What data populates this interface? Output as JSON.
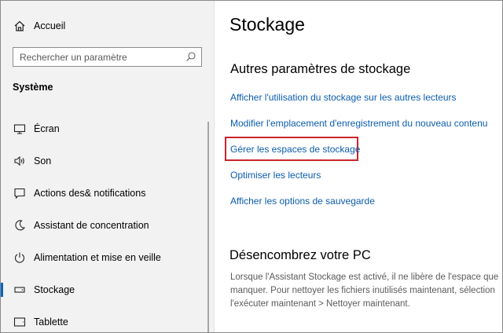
{
  "sidebar": {
    "home_label": "Accueil",
    "search_placeholder": "Rechercher un paramètre",
    "group_title": "Système",
    "items": [
      {
        "label": "Écran",
        "icon": "monitor-icon"
      },
      {
        "label": "Son",
        "icon": "speaker-icon"
      },
      {
        "label": "Actions des& notifications",
        "icon": "notification-icon"
      },
      {
        "label": "Assistant de concentration",
        "icon": "moon-icon"
      },
      {
        "label": "Alimentation et mise en veille",
        "icon": "power-icon"
      },
      {
        "label": "Stockage",
        "icon": "storage-icon",
        "active": true
      },
      {
        "label": "Tablette",
        "icon": "tablet-icon"
      }
    ]
  },
  "main": {
    "title": "Stockage",
    "section_title": "Autres paramètres de stockage",
    "links": [
      "Afficher l'utilisation du stockage sur les autres lecteurs",
      "Modifier l'emplacement d'enregistrement du nouveau contenu",
      "Gérer les espaces de stockage",
      "Optimiser les lecteurs",
      "Afficher les options de sauvegarde"
    ],
    "section2_title": "Désencombrez votre PC",
    "description_lines": [
      "Lorsque l'Assistant Stockage est activé, il ne libère de l'espace que",
      "manquer. Pour nettoyer les fichiers inutilisés maintenant, sélection",
      "l'exécuter maintenant > Nettoyer maintenant."
    ]
  },
  "colors": {
    "accent": "#0067c0",
    "link": "#0b5cad",
    "highlight_border": "#c9262c",
    "sidebar_bg": "#f2f2f2"
  }
}
